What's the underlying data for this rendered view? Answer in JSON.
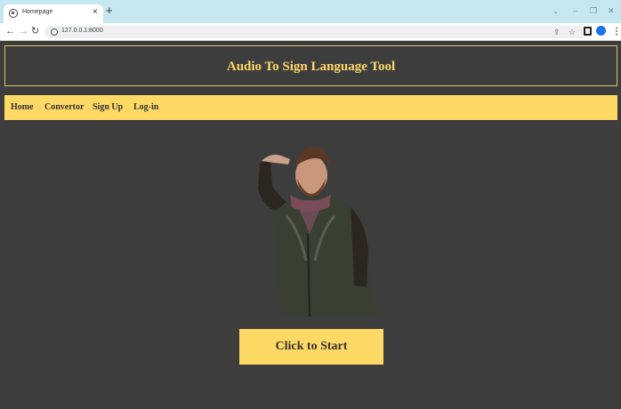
{
  "browser": {
    "tab_title": "Homepage",
    "tab_close": "×",
    "new_tab": "+",
    "url": "127.0.0.1:8000",
    "window_controls": {
      "collapse": "⌄",
      "minimize": "–",
      "maximize": "❐",
      "close": "✕"
    }
  },
  "site": {
    "title": "Audio To Sign Language Tool",
    "nav": [
      "Home",
      "Convertor",
      "Sign Up",
      "Log-in"
    ],
    "cta_label": "Click to Start"
  },
  "colors": {
    "accent": "#ffd966",
    "background": "#3d3d3d",
    "nav_text": "#333333"
  }
}
